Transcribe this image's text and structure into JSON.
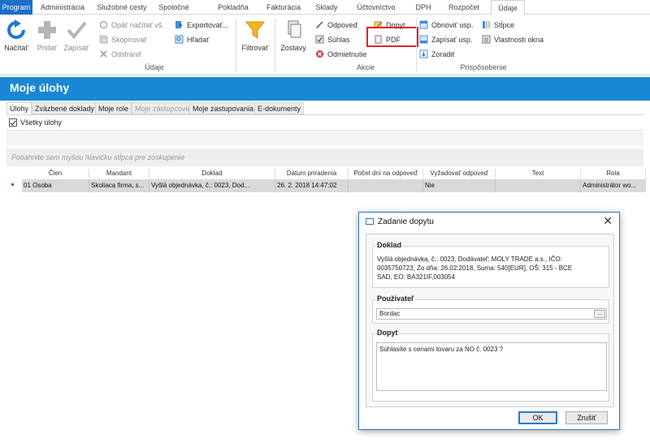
{
  "menu": {
    "tabs": [
      "Program",
      "Administrácia",
      "Služobné cesty",
      "Spoločné",
      "Pokladňa",
      "Fakturácia",
      "Sklady",
      "Účtovníctvo",
      "DPH",
      "Rozpočet",
      "Údaje"
    ],
    "active": "Údaje"
  },
  "ribbon": {
    "nacitat": "Načítať",
    "pridat": "Pridať",
    "zapisat": "Zapísať",
    "opat_nacitat": "Opäť načítať vš.",
    "skopirovat": "Skopírovať",
    "odstranit": "Odstrániť",
    "exportovat": "Exportovať...",
    "hladat": "Hľadať",
    "filtrovat": "Filtrovať",
    "zostavy": "Zostavy",
    "odpoved": "Odpoveď",
    "suhlas": "Súhlas",
    "odmietnutie": "Odmietnutie",
    "dopyt": "Dopyt",
    "pdf": "PDF",
    "obnovit_usp": "Obnoviť usp.",
    "zapisat_usp": "Zapísať usp.",
    "zoradit": "Zoradiť",
    "stlpce": "Stĺpce",
    "vlastnosti_okna": "Vlastnosti okna",
    "group_udaje": "Údaje",
    "group_akcie": "Akcie",
    "group_prisposobenie": "Prispôsobenie"
  },
  "page": {
    "title": "Moje úlohy",
    "subtabs": [
      "Úlohy",
      "Zväzbené doklady",
      "Moje role",
      "Moje zástupcovia",
      "Moje zastupovania",
      "E-dokumenty"
    ],
    "checkbox_label": "Všetky úlohy",
    "group_hint": "Potiahnite sem myšou hlavičku stĺpca pre zoskupenie"
  },
  "grid": {
    "headers": [
      "Člen",
      "Mandant",
      "Doklad",
      "Dátum priradenia",
      "Počet dní na odpoveď",
      "Vyžadovať odpoveď",
      "Text",
      "Rola"
    ],
    "rows": [
      [
        "01 Osoba",
        "Skoliaca firma, s...",
        "Vyšlá objednávka,  č.: 0023,  Dod...",
        "26. 2. 2018 14:47:02",
        "",
        "Nie",
        "",
        "Administrátor wo..."
      ]
    ]
  },
  "dialog": {
    "title": "Zadanie dopytu",
    "doklad_label": "Doklad",
    "doklad_text": "Vyšlá objednávka,  č.: 0023,  Dodávateľ: MOLY TRADE a.s.,  IČO: 0035750723,  Zo dňa: 26.02.2018,  Suma: 540[EUR],  OŠ: 315 - BCE SAD, EO: BA321IF,003054",
    "pouzivatel_label": "Používateľ",
    "pouzivatel_value": "Bordac",
    "ellipsis": "...",
    "dopyt_label": "Dopyt",
    "dopyt_text": "Súhlasíte s cenami tovaru za NO č. 0023 ?",
    "ok": "OK",
    "cancel": "Zrušiť"
  },
  "colors": {
    "program_tab": "#1e6fc9",
    "title_bar": "#1a87d5",
    "highlight_box": "#e1232a"
  }
}
